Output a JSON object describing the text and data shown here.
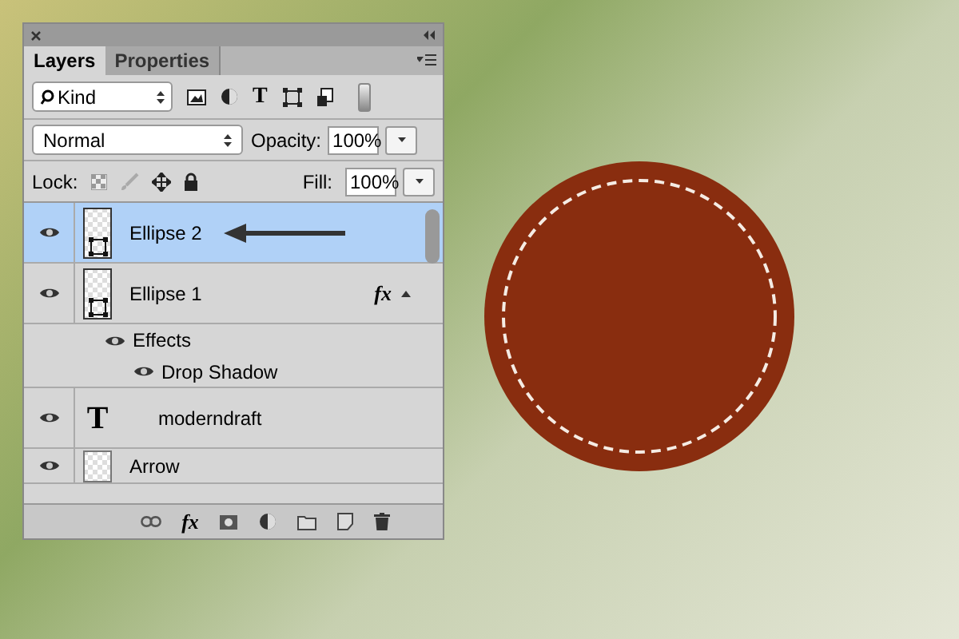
{
  "panel": {
    "tabs": [
      {
        "label": "Layers",
        "selected": true
      },
      {
        "label": "Properties",
        "selected": false
      }
    ],
    "filter": {
      "value": "Kind",
      "type_glyph": "T"
    },
    "blend_mode": {
      "value": "Normal"
    },
    "opacity": {
      "label": "Opacity:",
      "value": "100%"
    },
    "lock": {
      "label": "Lock:"
    },
    "fill": {
      "label": "Fill:",
      "value": "100%"
    },
    "layers": [
      {
        "name": "Ellipse 2",
        "kind": "shape",
        "selected": true,
        "visible": true,
        "arrow": true
      },
      {
        "name": "Ellipse 1",
        "kind": "shape",
        "selected": false,
        "visible": true,
        "fx": "fx",
        "effects": [
          {
            "name": "Effects",
            "visible": true,
            "children": [
              {
                "name": "Drop Shadow",
                "visible": true
              }
            ]
          }
        ]
      },
      {
        "name": "moderndraft",
        "kind": "text",
        "selected": false,
        "visible": true,
        "type_glyph": "T"
      },
      {
        "name": "Arrow",
        "kind": "pixel",
        "selected": false,
        "visible": true
      }
    ],
    "footer": {
      "fx": "fx"
    }
  }
}
